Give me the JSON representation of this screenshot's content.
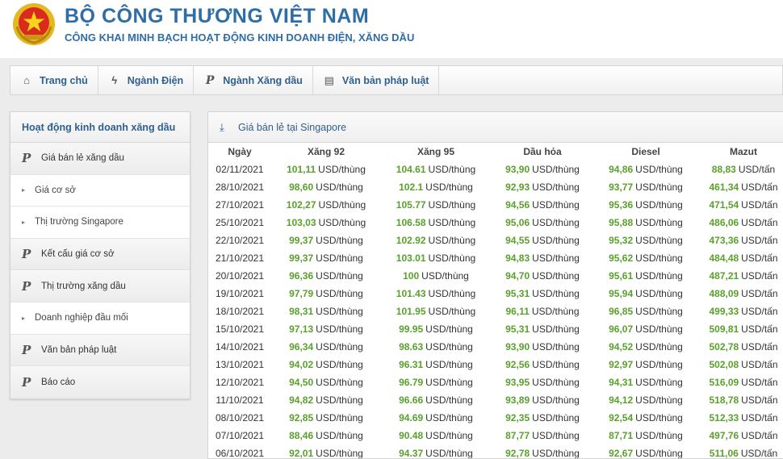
{
  "header": {
    "title": "BỘ CÔNG THƯƠNG VIỆT NAM",
    "subtitle": "CÔNG KHAI MINH BẠCH HOẠT ĐỘNG KINH DOANH ĐIỆN, XĂNG DẦU"
  },
  "nav": {
    "items": [
      {
        "label": "Trang chủ",
        "icon": "home-icon"
      },
      {
        "label": "Ngành Điện",
        "icon": "lightning-icon"
      },
      {
        "label": "Ngành Xăng dầu",
        "icon": "p-icon"
      },
      {
        "label": "Văn bản pháp luật",
        "icon": "document-icon"
      }
    ]
  },
  "sidebar": {
    "title": "Hoạt động kinh doanh xăng dầu",
    "items": [
      {
        "label": "Giá bán lẻ xăng dầu",
        "type": "main"
      },
      {
        "label": "Giá cơ sở",
        "type": "sub"
      },
      {
        "label": "Thị trường Singapore",
        "type": "sub"
      },
      {
        "label": "Kết cấu giá cơ sở",
        "type": "main"
      },
      {
        "label": "Thị trường xăng dầu",
        "type": "main"
      },
      {
        "label": "Doanh nghiệp đầu mối",
        "type": "sub"
      },
      {
        "label": "Văn bản pháp luật",
        "type": "main"
      },
      {
        "label": "Báo cáo",
        "type": "main"
      }
    ]
  },
  "panel": {
    "title": "Giá bán lẻ tại Singapore",
    "columns": [
      "Ngày",
      "Xăng 92",
      "Xăng 95",
      "Dầu hỏa",
      "Diesel",
      "Mazut"
    ],
    "units": [
      "USD/thùng",
      "USD/thùng",
      "USD/thùng",
      "USD/thùng",
      "USD/tấn"
    ],
    "rows": [
      [
        "02/11/2021",
        "101,11",
        "104.61",
        "93,90",
        "94,86",
        "88,83"
      ],
      [
        "28/10/2021",
        "98,60",
        "102.1",
        "92,93",
        "93,77",
        "461,34"
      ],
      [
        "27/10/2021",
        "102,27",
        "105.77",
        "94,56",
        "95,36",
        "471,54"
      ],
      [
        "25/10/2021",
        "103,03",
        "106.58",
        "95,06",
        "95,88",
        "486,06"
      ],
      [
        "22/10/2021",
        "99,37",
        "102.92",
        "94,55",
        "95,32",
        "473,36"
      ],
      [
        "21/10/2021",
        "99,37",
        "103.01",
        "94,83",
        "95,62",
        "484,48"
      ],
      [
        "20/10/2021",
        "96,36",
        "100",
        "94,70",
        "95,61",
        "487,21"
      ],
      [
        "19/10/2021",
        "97,79",
        "101.43",
        "95,31",
        "95,94",
        "488,09"
      ],
      [
        "18/10/2021",
        "98,31",
        "101.95",
        "96,11",
        "96,85",
        "499,33"
      ],
      [
        "15/10/2021",
        "97,13",
        "99.95",
        "95,31",
        "96,07",
        "509,81"
      ],
      [
        "14/10/2021",
        "96,34",
        "98.63",
        "93,90",
        "94,52",
        "502,78"
      ],
      [
        "13/10/2021",
        "94,02",
        "96.31",
        "92,56",
        "92,97",
        "502,08"
      ],
      [
        "12/10/2021",
        "94,50",
        "96.79",
        "93,95",
        "94,31",
        "516,09"
      ],
      [
        "11/10/2021",
        "94,82",
        "96.66",
        "93,89",
        "94,12",
        "518,78"
      ],
      [
        "08/10/2021",
        "92,85",
        "94.69",
        "92,35",
        "92,54",
        "512,33"
      ],
      [
        "07/10/2021",
        "88,46",
        "90.48",
        "87,77",
        "87,71",
        "497,76"
      ],
      [
        "06/10/2021",
        "92,01",
        "94.37",
        "92,78",
        "92,67",
        "511,06"
      ]
    ]
  },
  "colors": {
    "brand": "#2f6da6",
    "value_green": "#5aa02c"
  }
}
